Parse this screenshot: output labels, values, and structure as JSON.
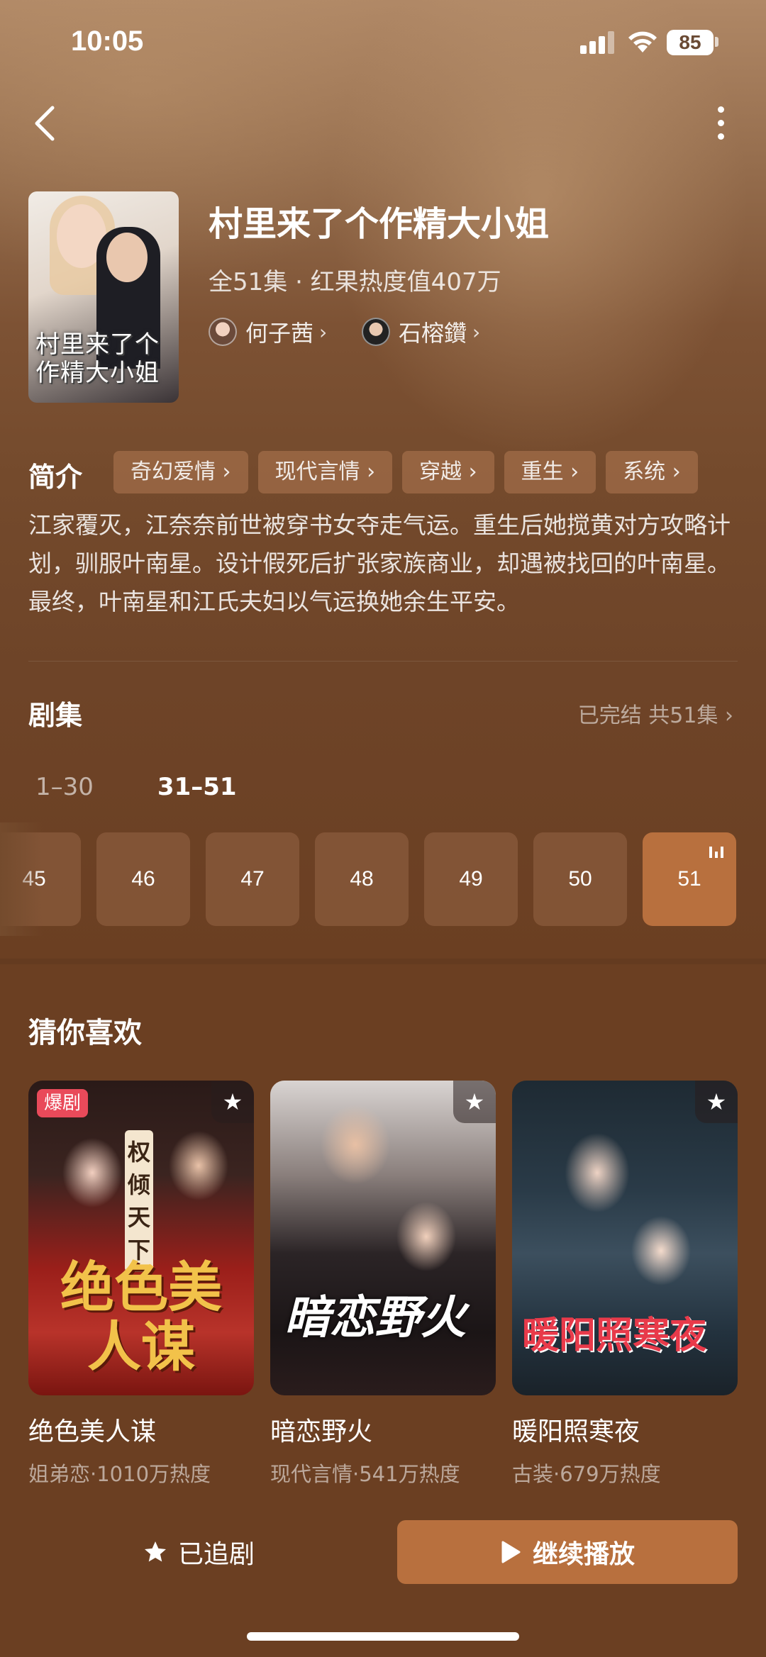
{
  "status_bar": {
    "time": "10:05",
    "battery": "85"
  },
  "show": {
    "title": "村里来了个作精大小姐",
    "meta": "全51集 · 红果热度值407万",
    "cover_title": "村里来了个作精大小姐",
    "cast": [
      {
        "name": "何子茜"
      },
      {
        "name": "石榕鑽"
      }
    ]
  },
  "synopsis": {
    "label": "简介",
    "tags": [
      "奇幻爱情",
      "现代言情",
      "穿越",
      "重生",
      "系统"
    ],
    "text": "江家覆灭，江奈奈前世被穿书女夺走气运。重生后她搅黄对方攻略计划，驯服叶南星。设计假死后扩张家族商业，却遇被找回的叶南星。最终，叶南星和江氏夫妇以气运换她余生平安。"
  },
  "episodes": {
    "label": "剧集",
    "status": "已完结 共51集 ›",
    "ranges": [
      "1–30",
      "31–51"
    ],
    "active_range": "31–51",
    "visible": [
      "45",
      "46",
      "47",
      "48",
      "49",
      "50",
      "51"
    ],
    "current": "51"
  },
  "recommendations": {
    "label": "猜你喜欢",
    "items": [
      {
        "title": "绝色美人谋",
        "sub": "姐弟恋·1010万热度",
        "badge": "爆剧",
        "poster_text_top": "权倾天下",
        "poster_text_main": "绝色美人谋"
      },
      {
        "title": "暗恋野火",
        "sub": "现代言情·541万热度",
        "poster_text_main": "暗恋野火"
      },
      {
        "title": "暖阳照寒夜",
        "sub": "古装·679万热度",
        "poster_text_main": "暖阳照寒夜"
      }
    ]
  },
  "actions": {
    "follow_label": "已追剧",
    "play_label": "继续播放"
  },
  "colors": {
    "accent": "#b8703e",
    "background": "#6b3f22",
    "hot_badge": "#e94a5a"
  }
}
